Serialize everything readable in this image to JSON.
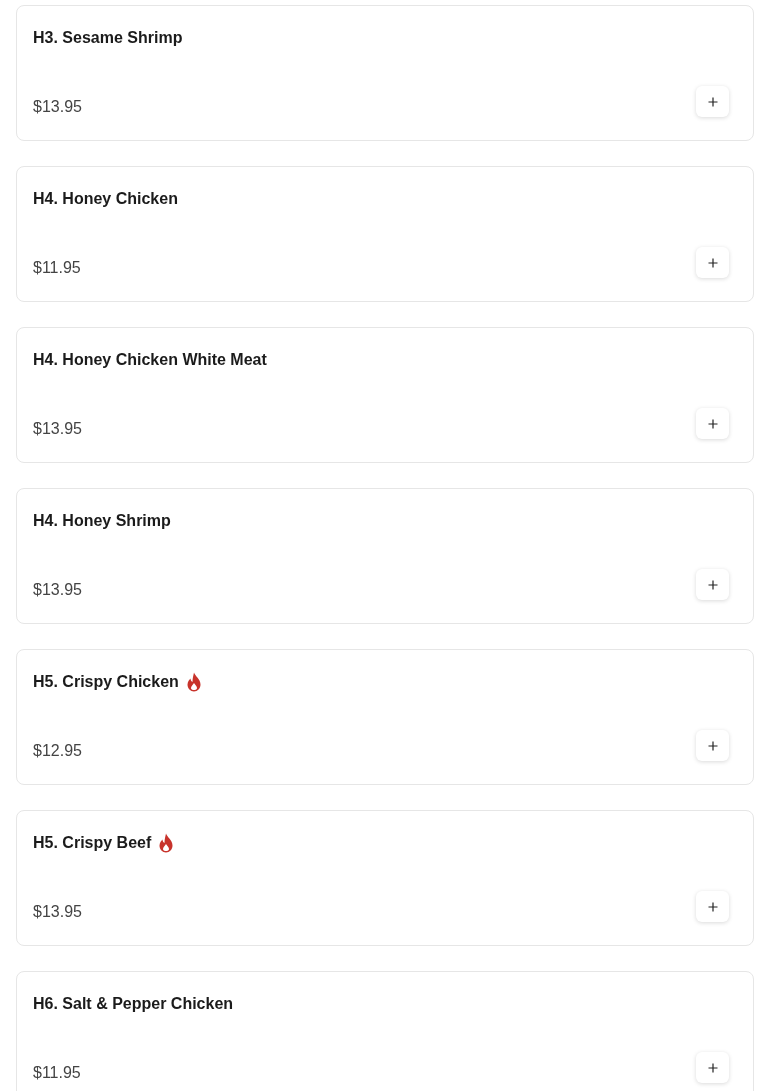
{
  "menu_items": [
    {
      "name": "H3. Sesame Shrimp",
      "spicy": false,
      "price": "$13.95"
    },
    {
      "name": "H4. Honey Chicken",
      "spicy": false,
      "price": "$11.95"
    },
    {
      "name": "H4. Honey Chicken White Meat",
      "spicy": false,
      "price": "$13.95"
    },
    {
      "name": "H4. Honey Shrimp",
      "spicy": false,
      "price": "$13.95"
    },
    {
      "name": "H5. Crispy Chicken",
      "spicy": true,
      "price": "$12.95"
    },
    {
      "name": "H5. Crispy Beef",
      "spicy": true,
      "price": "$13.95"
    },
    {
      "name": "H6. Salt & Pepper Chicken",
      "spicy": false,
      "price": "$11.95"
    }
  ]
}
